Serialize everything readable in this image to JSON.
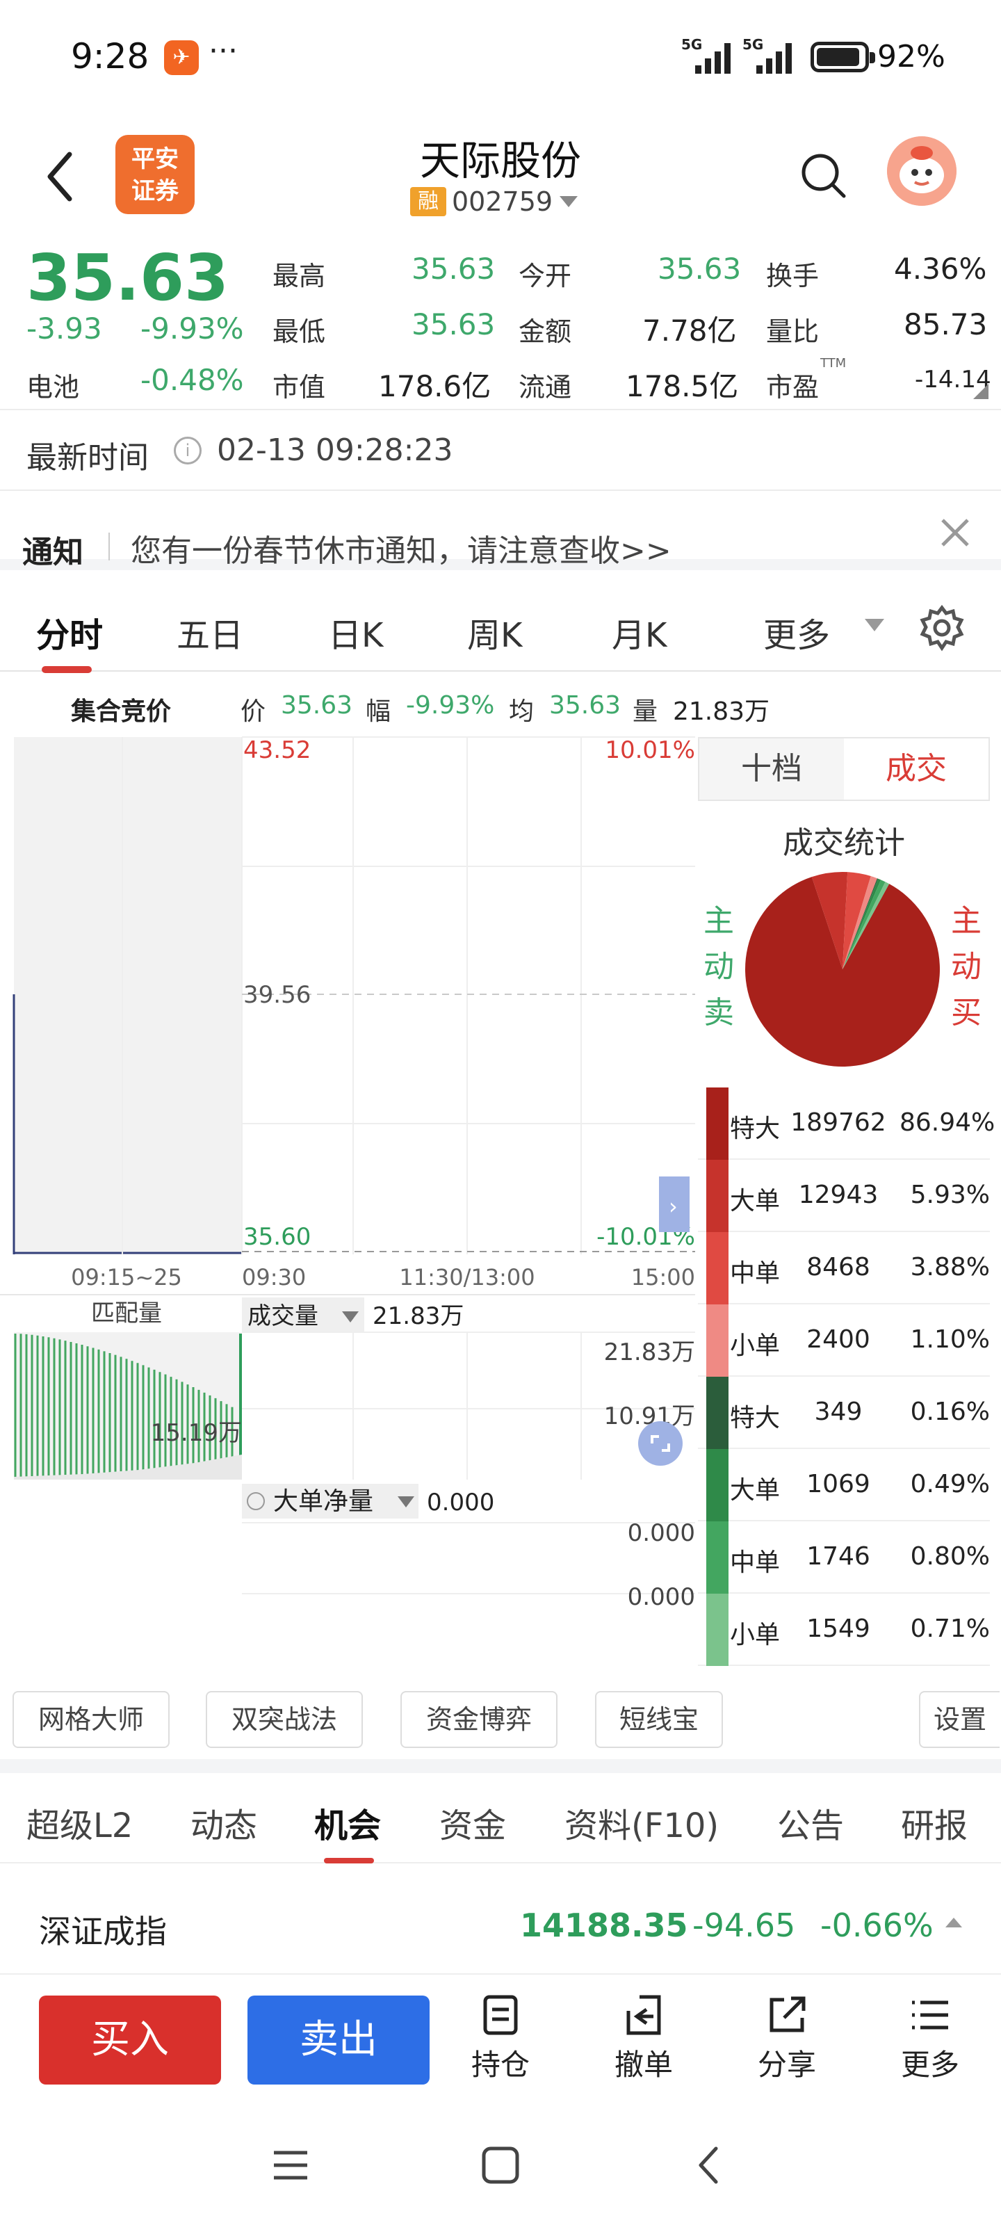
{
  "status_bar": {
    "time": "9:28",
    "app_badge": "✈",
    "more": "···",
    "net1": "5G",
    "net2": "5G",
    "battery_level": 0.92,
    "battery": "92%"
  },
  "header": {
    "broker_logo": "平安证券",
    "stock_name": "天际股份",
    "margin_tag": "融",
    "stock_code": "002759"
  },
  "quote": {
    "price": "35.63",
    "change": "-3.93",
    "change_pct": "-9.93%",
    "sector_label": "电池",
    "sector_pct": "-0.48%",
    "high_label": "最高",
    "high": "35.63",
    "low_label": "最低",
    "low": "35.63",
    "mcap_label": "市值",
    "mcap": "178.6亿",
    "open_label": "今开",
    "open": "35.63",
    "amount_label": "金额",
    "amount": "7.78亿",
    "float_label": "流通",
    "float": "178.5亿",
    "turnover_label": "换手",
    "turnover": "4.36%",
    "volratio_label": "量比",
    "volratio": "85.73",
    "pe_label": "市盈",
    "pe_sup": "TTM",
    "pe": "-14.14"
  },
  "update": {
    "label": "最新时间",
    "info": "i",
    "value": "02-13 09:28:23"
  },
  "notice": {
    "label": "通知",
    "text": "您有一份春节休市通知，请注意查收>>"
  },
  "chart_tabs": [
    "分时",
    "五日",
    "日K",
    "周K",
    "月K",
    "更多"
  ],
  "chart_info": {
    "auction": "集合竞价",
    "price_label": "价",
    "price": "35.63",
    "range_label": "幅",
    "range": "-9.93%",
    "avg_label": "均",
    "avg": "35.63",
    "vol_label": "量",
    "vol": "21.83万"
  },
  "chart": {
    "y_top": "43.52",
    "y_mid": "39.56",
    "y_bot": "35.60",
    "pct_top": "10.01%",
    "pct_bot": "-10.01%",
    "x_labels": [
      "09:15~25",
      "09:30",
      "11:30/13:00",
      "15:00"
    ],
    "match_label": "匹配量",
    "match_value": "15.19万",
    "vol_label": "成交量",
    "vol_value": "21.83万",
    "vol_top": "21.83万",
    "vol_mid": "10.91万",
    "net_label": "大单净量",
    "net_value": "0.000",
    "net_top": "0.000",
    "net_bot": "0.000"
  },
  "side": {
    "tabs": [
      "十档",
      "成交"
    ],
    "title": "成交统计",
    "sell_label": "主动卖",
    "buy_label": "主动买",
    "pie": [
      {
        "label": "特大买",
        "pct": 86.94,
        "color": "#a8211b"
      },
      {
        "label": "大单买",
        "pct": 5.93,
        "color": "#c6332c"
      },
      {
        "label": "中单买",
        "pct": 3.88,
        "color": "#e04a42"
      },
      {
        "label": "小单买",
        "pct": 1.1,
        "color": "#ef8a84"
      },
      {
        "label": "特大卖",
        "pct": 0.16,
        "color": "#2b5d3b"
      },
      {
        "label": "大单卖",
        "pct": 0.49,
        "color": "#2f8a49"
      },
      {
        "label": "中单卖",
        "pct": 0.8,
        "color": "#43a660"
      },
      {
        "label": "小单卖",
        "pct": 0.71,
        "color": "#7bc38c"
      }
    ],
    "rows": [
      {
        "type": "特大",
        "count": "189762",
        "pct": "86.94%",
        "color": "#a8211b"
      },
      {
        "type": "大单",
        "count": "12943",
        "pct": "5.93%",
        "color": "#c6332c"
      },
      {
        "type": "中单",
        "count": "8468",
        "pct": "3.88%",
        "color": "#e04a42"
      },
      {
        "type": "小单",
        "count": "2400",
        "pct": "1.10%",
        "color": "#ef8a84"
      },
      {
        "type": "特大",
        "count": "349",
        "pct": "0.16%",
        "color": "#2b5d3b"
      },
      {
        "type": "大单",
        "count": "1069",
        "pct": "0.49%",
        "color": "#2f8a49"
      },
      {
        "type": "中单",
        "count": "1746",
        "pct": "0.80%",
        "color": "#43a660"
      },
      {
        "type": "小单",
        "count": "1549",
        "pct": "0.71%",
        "color": "#7bc38c"
      }
    ]
  },
  "tools": [
    "网格大师",
    "双突战法",
    "资金博弈",
    "短线宝",
    "设置"
  ],
  "sub_tabs": [
    "超级L2",
    "动态",
    "机会",
    "资金",
    "资料(F10)",
    "公告",
    "研报"
  ],
  "index": {
    "name": "深证成指",
    "value": "14188.35",
    "change": "-94.65",
    "pct": "-0.66%"
  },
  "bottom": {
    "buy": "买入",
    "sell": "卖出",
    "hold": "持仓",
    "cancel": "撤单",
    "share": "分享",
    "more": "更多"
  },
  "colors": {
    "up": "#d93c36",
    "down": "#2e9d5b",
    "accent": "#d93c36",
    "buy": "#d9302c",
    "sell": "#2d6ee6"
  }
}
